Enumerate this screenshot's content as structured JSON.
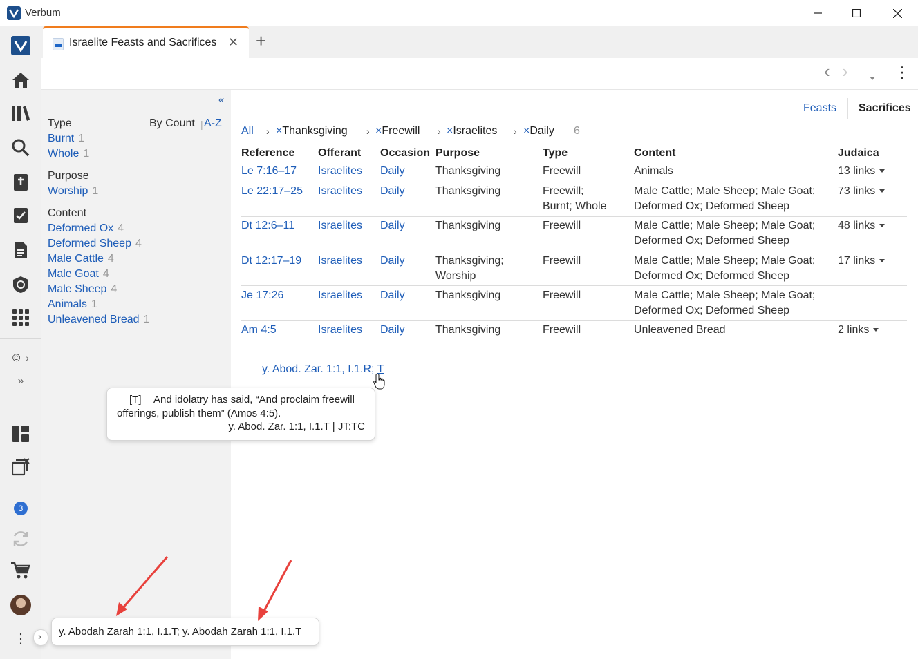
{
  "window": {
    "app_title": "Verbum",
    "minimize": "—",
    "maximize": "☐",
    "close": "✕"
  },
  "tab": {
    "title": "Israelite Feasts and Sacrifices",
    "close": "✕",
    "add": "+"
  },
  "rail": {
    "badge_count": "3",
    "copyright": "©"
  },
  "toolbar": {
    "back": "‹",
    "forward": "›",
    "more": "⋮"
  },
  "filters": {
    "collapse": "«",
    "sort_by_count": "By Count",
    "sort_az": "A-Z",
    "groups": [
      {
        "title": "Type",
        "items": [
          {
            "label": "Burnt",
            "count": "1"
          },
          {
            "label": "Whole",
            "count": "1"
          }
        ]
      },
      {
        "title": "Purpose",
        "items": [
          {
            "label": "Worship",
            "count": "1"
          }
        ]
      },
      {
        "title": "Content",
        "items": [
          {
            "label": "Deformed Ox",
            "count": "4"
          },
          {
            "label": "Deformed Sheep",
            "count": "4"
          },
          {
            "label": "Male Cattle",
            "count": "4"
          },
          {
            "label": "Male Goat",
            "count": "4"
          },
          {
            "label": "Male Sheep",
            "count": "4"
          },
          {
            "label": "Animals",
            "count": "1"
          },
          {
            "label": "Unleavened Bread",
            "count": "1"
          }
        ]
      }
    ]
  },
  "modes": {
    "feasts": "Feasts",
    "sacrifices": "Sacrifices"
  },
  "breadcrumbs": {
    "all": "All",
    "items": [
      "Thanksgiving",
      "Freewill",
      "Israelites",
      "Daily"
    ],
    "remove_glyph": "×",
    "result_count": "6"
  },
  "table": {
    "headers": [
      "Reference",
      "Offerant",
      "Occasion",
      "Purpose",
      "Type",
      "Content",
      "Judaica"
    ],
    "rows": [
      {
        "reference": "Le 7:16–17",
        "offerant": "Israelites",
        "occasion": "Daily",
        "purpose": [
          "Thanksgiving"
        ],
        "type": [
          "Freewill"
        ],
        "content": [
          "Animals"
        ],
        "judaica": "13 links"
      },
      {
        "reference": "Le 22:17–25",
        "offerant": "Israelites",
        "occasion": "Daily",
        "purpose": [
          "Thanksgiving"
        ],
        "type": [
          "Freewill;",
          "Burnt; Whole"
        ],
        "content": [
          "Male Cattle; Male Sheep; Male Goat;",
          "Deformed Ox; Deformed Sheep"
        ],
        "judaica": "73 links"
      },
      {
        "reference": "Dt 12:6–11",
        "offerant": "Israelites",
        "occasion": "Daily",
        "purpose": [
          "Thanksgiving"
        ],
        "type": [
          "Freewill"
        ],
        "content": [
          "Male Cattle; Male Sheep; Male Goat;",
          "Deformed Ox; Deformed Sheep"
        ],
        "judaica": "48 links"
      },
      {
        "reference": "Dt 12:17–19",
        "offerant": "Israelites",
        "occasion": "Daily",
        "purpose": [
          "Thanksgiving;",
          "Worship"
        ],
        "type": [
          "Freewill"
        ],
        "content": [
          "Male Cattle; Male Sheep; Male Goat;",
          "Deformed Ox; Deformed Sheep"
        ],
        "judaica": "17 links"
      },
      {
        "reference": "Je 17:26",
        "offerant": "Israelites",
        "occasion": "Daily",
        "purpose": [
          "Thanksgiving"
        ],
        "type": [
          "Freewill"
        ],
        "content": [
          "Male Cattle; Male Sheep; Male Goat;",
          "Deformed Ox; Deformed Sheep"
        ],
        "judaica": ""
      },
      {
        "reference": "Am 4:5",
        "offerant": "Israelites",
        "occasion": "Daily",
        "purpose": [
          "Thanksgiving"
        ],
        "type": [
          "Freewill"
        ],
        "content": [
          "Unleavened Bread"
        ],
        "judaica": "2 links"
      }
    ]
  },
  "expanded_refs": {
    "prefix": "y. Abod. Zar. 1:1, I.1.R; ",
    "link": "T"
  },
  "tooltip": {
    "marker": "[T]",
    "line1": "And idolatry has said, “And proclaim freewill",
    "line2": "offerings, publish them” (Amos 4:5).",
    "source": "y. Abod. Zar. 1:1, I.1.T | JT:TC"
  },
  "status_popup": {
    "text": "y. Abodah Zarah 1:1, I.1.T; y. Abodah Zarah 1:1, I.1.T",
    "expand": "›"
  },
  "colors": {
    "accent": "#f07c1d",
    "link": "#1e5db8",
    "arrow": "#e8413c"
  }
}
